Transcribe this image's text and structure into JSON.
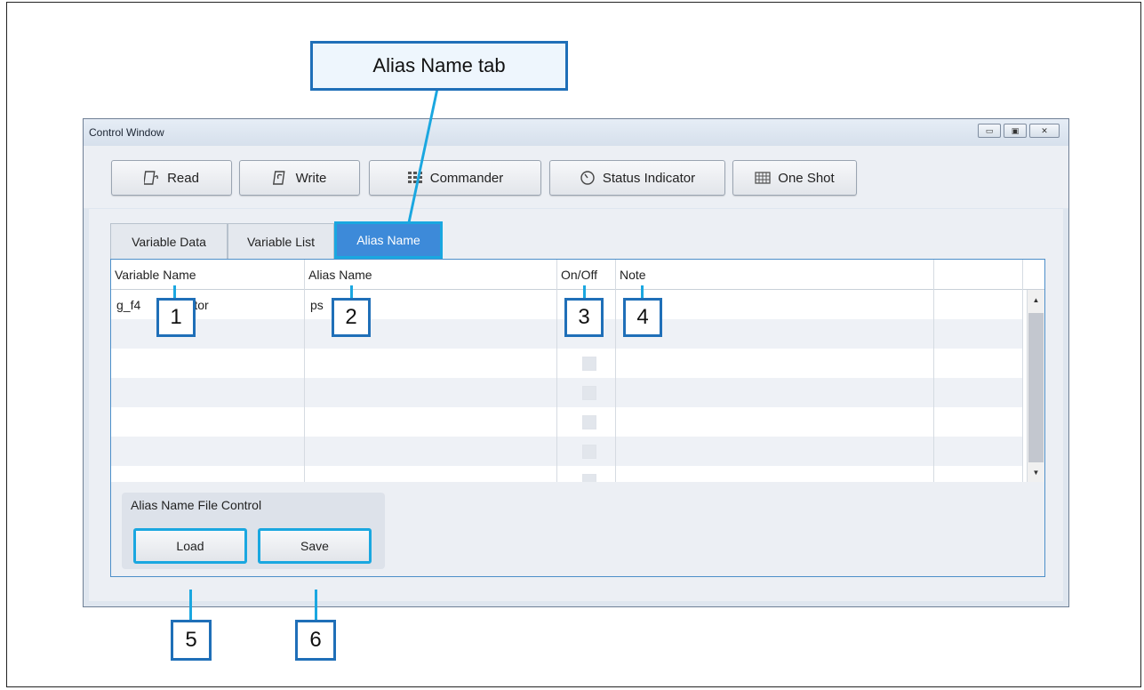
{
  "callouts": {
    "title": "Alias Name tab",
    "n1": "1",
    "n2": "2",
    "n3": "3",
    "n4": "4",
    "n5": "5",
    "n6": "6"
  },
  "window": {
    "title": "Control Window",
    "controls": {
      "minimize": "▭",
      "maximize": "▣",
      "close": "✕"
    }
  },
  "toolbar": {
    "buttons": [
      {
        "label": "Read",
        "icon": "read-icon"
      },
      {
        "label": "Write",
        "icon": "write-icon"
      },
      {
        "label": "Commander",
        "icon": "commander-icon"
      },
      {
        "label": "Status Indicator",
        "icon": "status-indicator-icon"
      },
      {
        "label": "One Shot",
        "icon": "one-shot-icon"
      }
    ]
  },
  "tabs": [
    "Variable Data",
    "Variable List",
    "Alias Name"
  ],
  "active_tab": "Alias Name",
  "grid": {
    "columns": [
      "Variable Name",
      "Alias Name",
      "On/Off",
      "Note",
      ""
    ],
    "rows": [
      {
        "variable": "g_f4",
        "variable_tail": "_monitor",
        "alias": "ps",
        "alias_tail": "e",
        "on": false,
        "note": ""
      }
    ]
  },
  "group": {
    "title": "Alias Name File Control",
    "load_label": "Load",
    "save_label": "Save"
  },
  "colors": {
    "accent": "#1aa7e0",
    "active_tab": "#3d8ad9",
    "callout_border": "#1f6fb8"
  }
}
